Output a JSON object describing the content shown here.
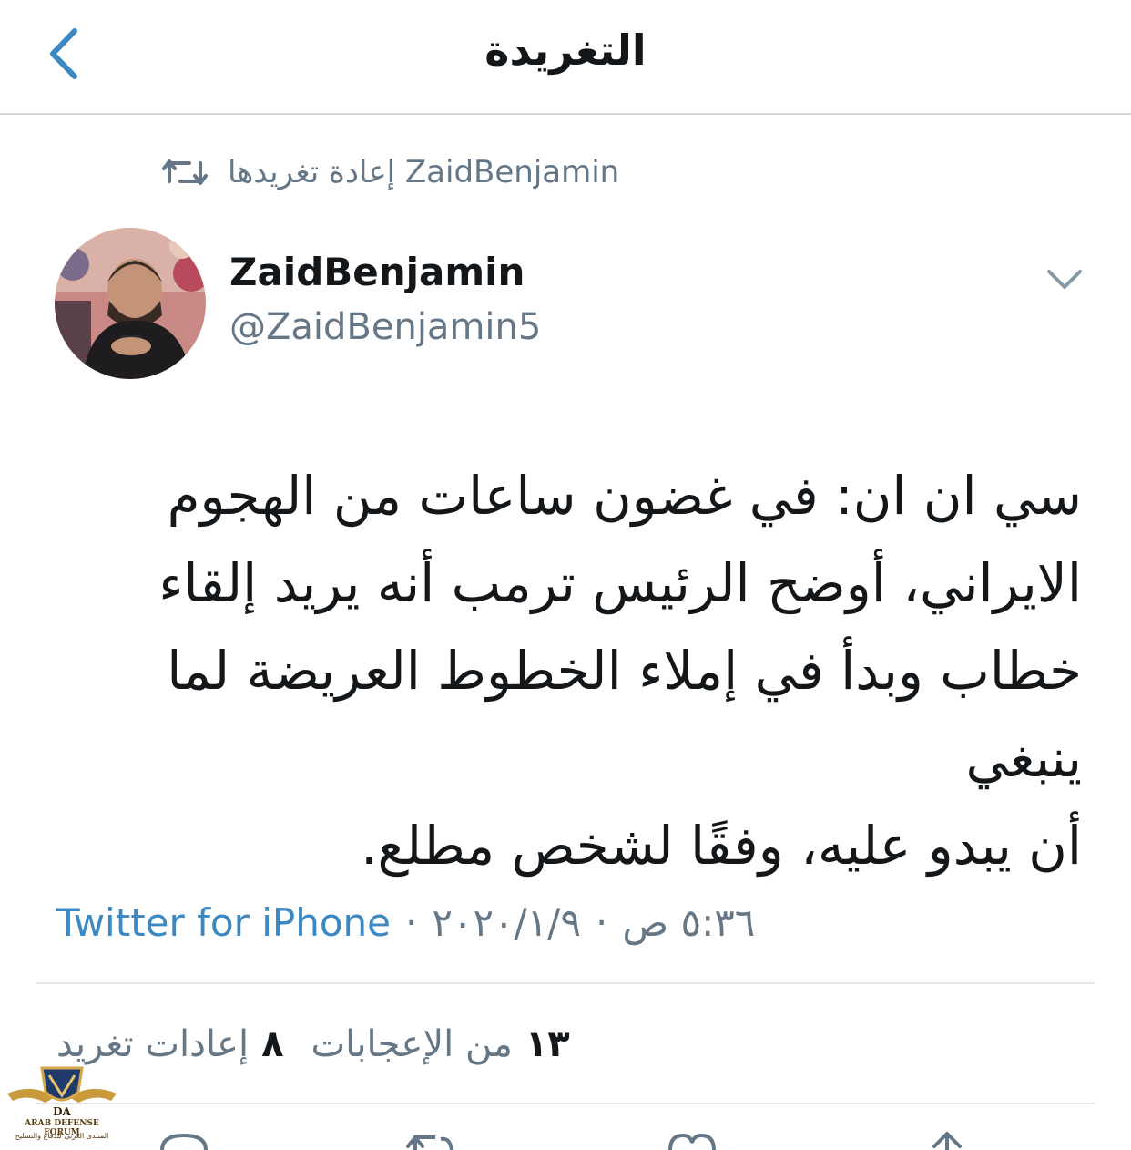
{
  "nav": {
    "title": "التغريدة",
    "back_icon": "chevron-left-icon"
  },
  "retweet_context": {
    "text": "ZaidBenjamin إعادة تغريدها",
    "icon": "retweet-icon"
  },
  "author": {
    "display_name": "ZaidBenjamin",
    "handle": "@ZaidBenjamin5",
    "avatar_icon": "avatar"
  },
  "tweet": {
    "lines": [
      "سي ان ان: في غضون ساعات من الهجوم",
      "الايراني، أوضح الرئيس ترمب أنه يريد إلقاء",
      "خطاب وبدأ في إملاء الخطوط العريضة لما ينبغي",
      "أن يبدو عليه، وفقًا لشخص مطلع."
    ]
  },
  "meta": {
    "source": "Twitter for iPhone",
    "separator": "·",
    "date": "٢٠٢٠/١/٩",
    "time": "٥:٣٦ ص"
  },
  "stats": {
    "retweets_count": "٨",
    "retweets_label": "إعادات تغريد",
    "likes_count": "١٣",
    "likes_label": "من الإعجابات"
  },
  "watermark": {
    "emblem": "DA",
    "line1": "ARAB DEFENSE FORUM",
    "line2": "المنتدى العربي للدفاع والتسليح"
  },
  "colors": {
    "accent": "#3b88c3",
    "secondary_text": "#657786",
    "primary_text": "#14171a",
    "divider": "#e1e5e8"
  }
}
